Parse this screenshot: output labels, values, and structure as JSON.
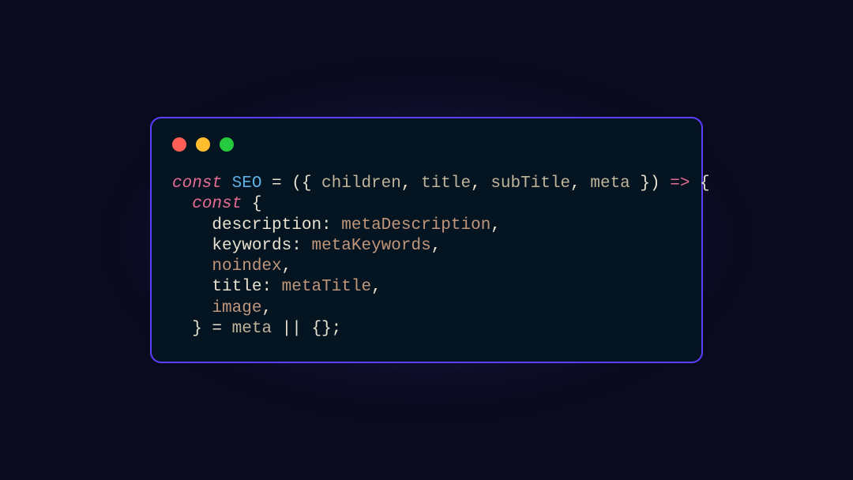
{
  "window": {
    "dots": [
      "red",
      "yellow",
      "green"
    ]
  },
  "code": {
    "line1_const": "const",
    "line1_fn": " SEO ",
    "line1_eq_open": "= ({ ",
    "line1_p1": "children",
    "line1_c1": ", ",
    "line1_p2": "title",
    "line1_c2": ", ",
    "line1_p3": "subTitle",
    "line1_c3": ", ",
    "line1_p4": "meta",
    "line1_close": " }) ",
    "line1_arrow": "=>",
    "line1_brace": " {",
    "line2_indent": "  ",
    "line2_const": "const",
    "line2_brace": " {",
    "line3_indent": "    ",
    "line3_key": "description",
    "line3_colon": ": ",
    "line3_val": "metaDescription",
    "line3_comma": ",",
    "line4_indent": "    ",
    "line4_key": "keywords",
    "line4_colon": ": ",
    "line4_val": "metaKeywords",
    "line4_comma": ",",
    "line5_indent": "    ",
    "line5_key": "noindex",
    "line5_comma": ",",
    "line6_indent": "    ",
    "line6_key": "title",
    "line6_colon": ": ",
    "line6_val": "metaTitle",
    "line6_comma": ",",
    "line7_indent": "    ",
    "line7_key": "image",
    "line7_comma": ",",
    "line8_indent": "  ",
    "line8_close": "} = ",
    "line8_meta": "meta",
    "line8_or": " || {};"
  }
}
